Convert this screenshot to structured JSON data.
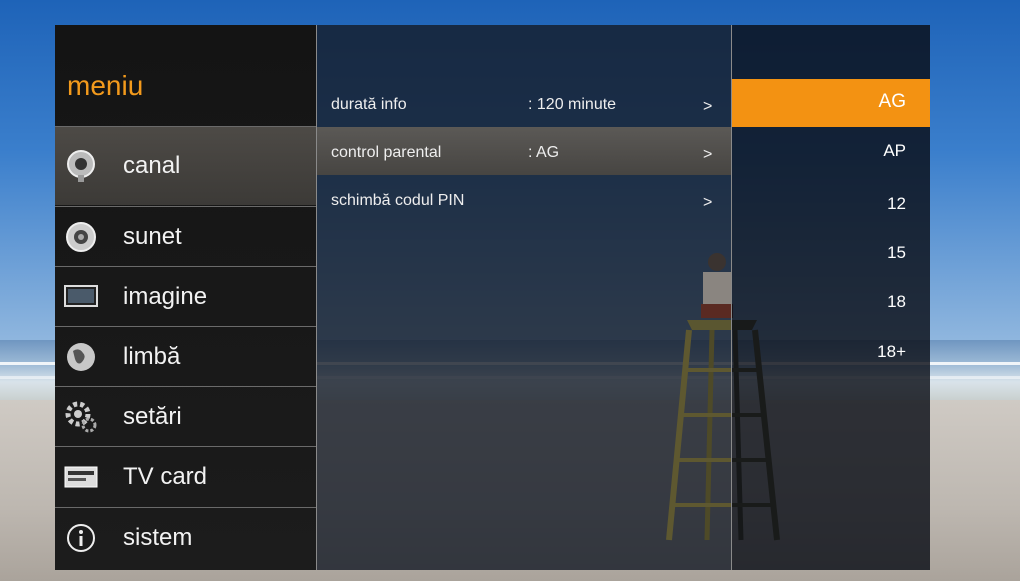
{
  "menu": {
    "title": "meniu",
    "items": [
      {
        "label": "canal",
        "icon": "satellite-dish-icon",
        "active": true
      },
      {
        "label": "sunet",
        "icon": "speaker-icon",
        "active": false
      },
      {
        "label": "imagine",
        "icon": "monitor-icon",
        "active": false
      },
      {
        "label": "limbă",
        "icon": "globe-icon",
        "active": false
      },
      {
        "label": "setări",
        "icon": "gears-icon",
        "active": false
      },
      {
        "label": "TV card",
        "icon": "tv-card-icon",
        "active": false
      },
      {
        "label": "sistem",
        "icon": "info-icon",
        "active": false
      }
    ]
  },
  "submenu": {
    "rows": [
      {
        "name": "durată info",
        "value": ": 120 minute",
        "arrow": ">"
      },
      {
        "name": "control parental",
        "value": ": AG",
        "arrow": ">",
        "active": true
      },
      {
        "name": "schimbă codul PIN",
        "value": "",
        "arrow": ">"
      }
    ]
  },
  "options": {
    "items": [
      "AG",
      "AP",
      "12",
      "15",
      "18",
      "18+"
    ],
    "selected": "AG"
  },
  "colors": {
    "accent": "#f39212",
    "title": "#f39a1c"
  }
}
